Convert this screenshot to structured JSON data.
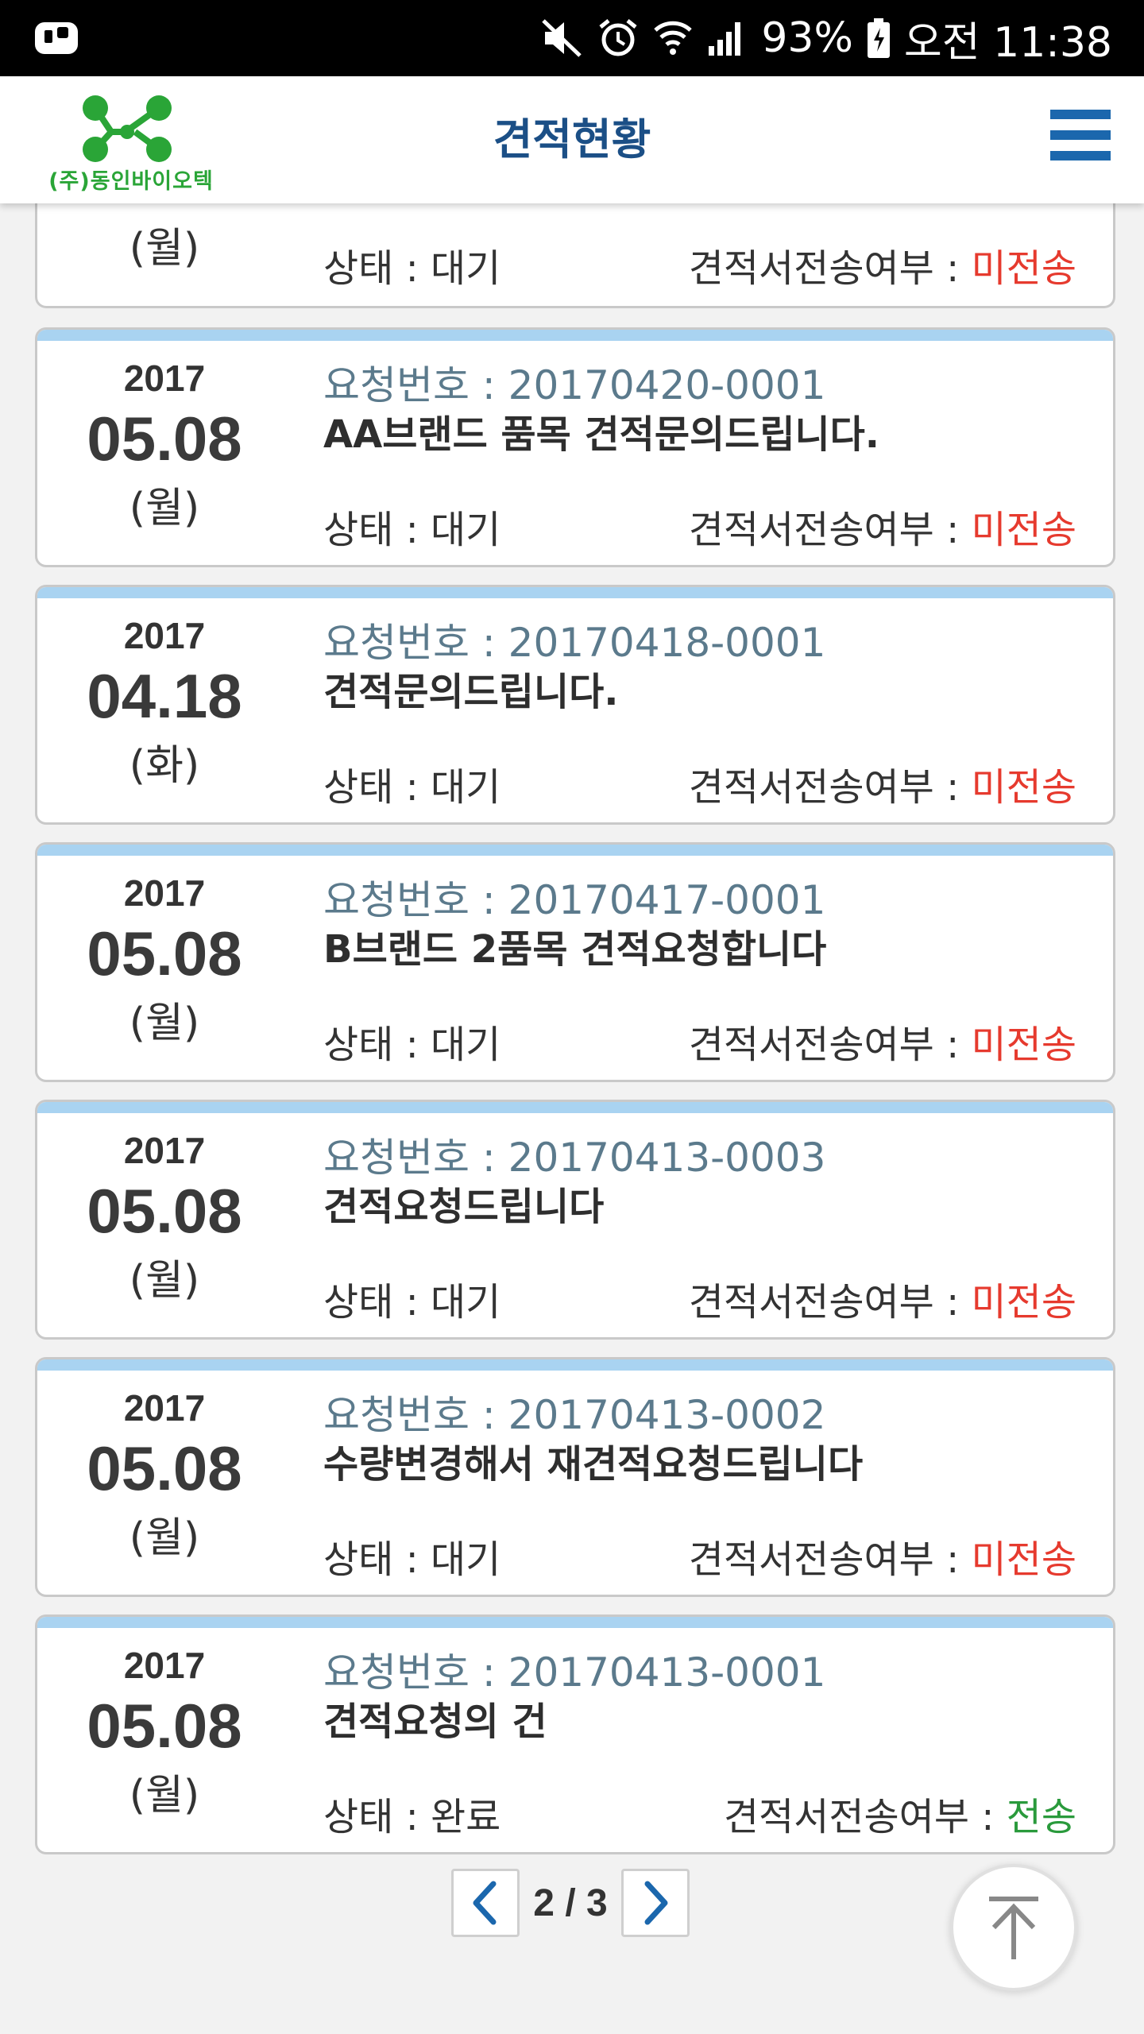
{
  "status_bar": {
    "battery": "93%",
    "time": "오전 11:38"
  },
  "header": {
    "company": "(주)동인바이오텍",
    "title": "견적현황"
  },
  "labels": {
    "request_prefix": "요청번호 : ",
    "status_prefix": "상태 : ",
    "send_prefix": "견적서전송여부 : "
  },
  "partial_card": {
    "dow": "(월)",
    "status": "상태 : 대기",
    "send_label": "견적서전송여부 : ",
    "send_value": "미전송"
  },
  "cards": [
    {
      "year": "2017",
      "md": "05.08",
      "dow": "(월)",
      "request": "요청번호 : 20170420-0001",
      "subject": "AA브랜드 품목 견적문의드립니다.",
      "status": "상태 : 대기",
      "send_label": "견적서전송여부 : ",
      "send_value": "미전송",
      "send_color": "red"
    },
    {
      "year": "2017",
      "md": "04.18",
      "dow": "(화)",
      "request": "요청번호 : 20170418-0001",
      "subject": "견적문의드립니다.",
      "status": "상태 : 대기",
      "send_label": "견적서전송여부 : ",
      "send_value": "미전송",
      "send_color": "red"
    },
    {
      "year": "2017",
      "md": "05.08",
      "dow": "(월)",
      "request": "요청번호 : 20170417-0001",
      "subject": "B브랜드 2품목 견적요청합니다",
      "status": "상태 : 대기",
      "send_label": "견적서전송여부 : ",
      "send_value": "미전송",
      "send_color": "red"
    },
    {
      "year": "2017",
      "md": "05.08",
      "dow": "(월)",
      "request": "요청번호 : 20170413-0003",
      "subject": "견적요청드립니다",
      "status": "상태 : 대기",
      "send_label": "견적서전송여부 : ",
      "send_value": "미전송",
      "send_color": "red"
    },
    {
      "year": "2017",
      "md": "05.08",
      "dow": "(월)",
      "request": "요청번호 : 20170413-0002",
      "subject": "수량변경해서 재견적요청드립니다",
      "status": "상태 : 대기",
      "send_label": "견적서전송여부 : ",
      "send_value": "미전송",
      "send_color": "red"
    },
    {
      "year": "2017",
      "md": "05.08",
      "dow": "(월)",
      "request": "요청번호 : 20170413-0001",
      "subject": "견적요청의 건",
      "status": "상태 : 완료",
      "send_label": "견적서전송여부 : ",
      "send_value": "전송",
      "send_color": "green"
    }
  ],
  "pager": {
    "text": "2 / 3"
  },
  "icons": {
    "menu": "hamburger-icon",
    "prev": "chevron-left-icon",
    "next": "chevron-right-icon",
    "top": "scroll-top-icon"
  },
  "colors": {
    "title": "#1b4f86",
    "accent_bar": "#a9d3f1",
    "unsent": "#e63a2e",
    "sent": "#2a9a3c",
    "logo": "#2aa537"
  }
}
